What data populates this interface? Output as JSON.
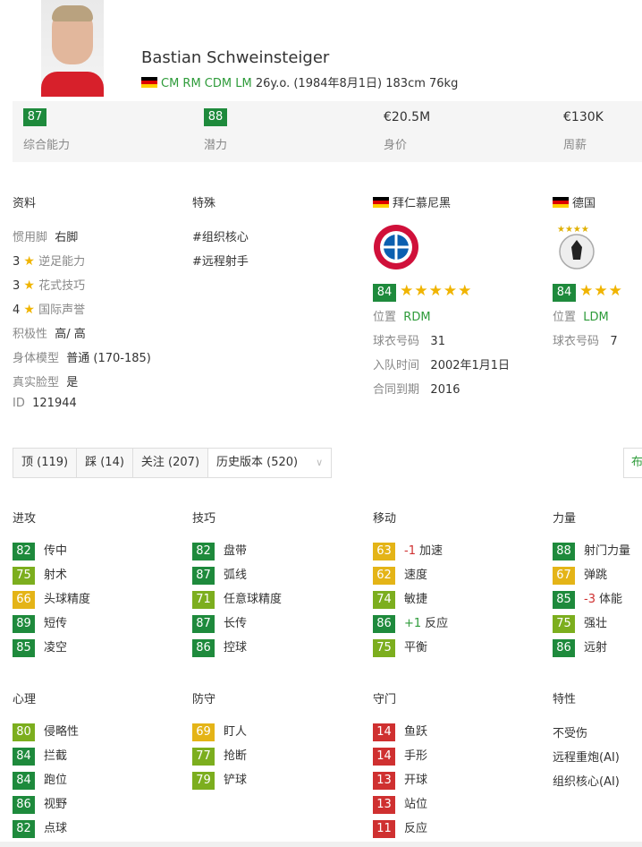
{
  "player": {
    "name": "Bastian Schweinsteiger",
    "positions": "CM RM CDM LM",
    "info": "26y.o. (1984年8月1日) 183cm 76kg"
  },
  "summary": [
    {
      "value": "87",
      "label": "综合能力",
      "kind": "badge",
      "color": "#1e8a3c"
    },
    {
      "value": "88",
      "label": "潜力",
      "kind": "badge",
      "color": "#1e8a3c"
    },
    {
      "value": "€20.5M",
      "label": "身价",
      "kind": "text"
    },
    {
      "value": "€130K",
      "label": "周薪",
      "kind": "text"
    }
  ],
  "profile": {
    "title": "资料",
    "foot_label": "惯用脚",
    "foot_value": "右脚",
    "weak_foot_num": "3",
    "weak_foot_label": "逆足能力",
    "skill_num": "3",
    "skill_label": "花式技巧",
    "rep_num": "4",
    "rep_label": "国际声誉",
    "work_label": "积极性",
    "work_value": "高/ 高",
    "body_label": "身体模型",
    "body_value": "普通 (170-185)",
    "face_label": "真实脸型",
    "face_value": "是",
    "id_label": "ID",
    "id_value": "121944"
  },
  "specialities": {
    "title": "特殊",
    "items": [
      "#组织核心",
      "#远程射手"
    ]
  },
  "club": {
    "name": "拜仁慕尼黑",
    "rating": "84",
    "stars": "★★★★★",
    "pos_label": "位置",
    "pos_value": "RDM",
    "kit_label": "球衣号码",
    "kit_value": "31",
    "joined_label": "入队时间",
    "joined_value": "2002年1月1日",
    "contract_label": "合同到期",
    "contract_value": "2016"
  },
  "national": {
    "name": "德国",
    "rating": "84",
    "stars": "★★★",
    "pos_label": "位置",
    "pos_value": "LDM",
    "kit_label": "球衣号码",
    "kit_value": "7"
  },
  "actions": {
    "like": "顶 (119)",
    "dislike": "踩 (14)",
    "follow": "关注 (207)",
    "history": "历史版本 (520)",
    "partial_right": "布"
  },
  "groups": {
    "attacking": {
      "title": "进攻",
      "items": [
        {
          "v": "82",
          "c": "g-dark",
          "n": "传中"
        },
        {
          "v": "75",
          "c": "g-light",
          "n": "射术"
        },
        {
          "v": "66",
          "c": "g-yellow",
          "n": "头球精度"
        },
        {
          "v": "89",
          "c": "g-dark",
          "n": "短传"
        },
        {
          "v": "85",
          "c": "g-dark",
          "n": "凌空"
        }
      ]
    },
    "skill": {
      "title": "技巧",
      "items": [
        {
          "v": "82",
          "c": "g-dark",
          "n": "盘带"
        },
        {
          "v": "87",
          "c": "g-dark",
          "n": "弧线"
        },
        {
          "v": "71",
          "c": "g-light",
          "n": "任意球精度"
        },
        {
          "v": "87",
          "c": "g-dark",
          "n": "长传"
        },
        {
          "v": "86",
          "c": "g-dark",
          "n": "控球"
        }
      ]
    },
    "movement": {
      "title": "移动",
      "items": [
        {
          "v": "63",
          "c": "g-yellow",
          "m": "-1",
          "mc": "mod-neg",
          "n": "加速"
        },
        {
          "v": "62",
          "c": "g-yellow",
          "n": "速度"
        },
        {
          "v": "74",
          "c": "g-light",
          "n": "敏捷"
        },
        {
          "v": "86",
          "c": "g-dark",
          "m": "+1",
          "mc": "mod-pos",
          "n": "反应"
        },
        {
          "v": "75",
          "c": "g-light",
          "n": "平衡"
        }
      ]
    },
    "power": {
      "title": "力量",
      "items": [
        {
          "v": "88",
          "c": "g-dark",
          "n": "射门力量"
        },
        {
          "v": "67",
          "c": "g-yellow",
          "n": "弹跳"
        },
        {
          "v": "85",
          "c": "g-dark",
          "m": "-3",
          "mc": "mod-neg",
          "n": "体能"
        },
        {
          "v": "75",
          "c": "g-light",
          "n": "强壮"
        },
        {
          "v": "86",
          "c": "g-dark",
          "n": "远射"
        }
      ]
    },
    "mentality": {
      "title": "心理",
      "items": [
        {
          "v": "80",
          "c": "g-light",
          "n": "侵略性"
        },
        {
          "v": "84",
          "c": "g-dark",
          "n": "拦截"
        },
        {
          "v": "84",
          "c": "g-dark",
          "n": "跑位"
        },
        {
          "v": "86",
          "c": "g-dark",
          "n": "视野"
        },
        {
          "v": "82",
          "c": "g-dark",
          "n": "点球"
        }
      ]
    },
    "defending": {
      "title": "防守",
      "items": [
        {
          "v": "69",
          "c": "g-yellow",
          "n": "盯人"
        },
        {
          "v": "77",
          "c": "g-light",
          "n": "抢断"
        },
        {
          "v": "79",
          "c": "g-light",
          "n": "铲球"
        }
      ]
    },
    "goalkeeping": {
      "title": "守门",
      "items": [
        {
          "v": "14",
          "c": "g-red",
          "n": "鱼跃"
        },
        {
          "v": "14",
          "c": "g-red",
          "n": "手形"
        },
        {
          "v": "13",
          "c": "g-red",
          "n": "开球"
        },
        {
          "v": "13",
          "c": "g-red",
          "n": "站位"
        },
        {
          "v": "11",
          "c": "g-red",
          "n": "反应"
        }
      ]
    }
  },
  "traits": {
    "title": "特性",
    "items": [
      "不受伤",
      "远程重炮(AI)",
      "组织核心(AI)"
    ]
  }
}
